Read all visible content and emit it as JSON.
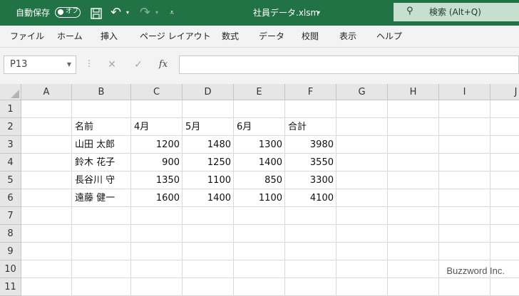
{
  "titlebar": {
    "autosave_label": "自動保存",
    "autosave_state": "オフ",
    "filename": "社員データ.xlsm",
    "search_placeholder": "検索 (Alt+Q)"
  },
  "menu": [
    "ファイル",
    "ホーム",
    "挿入",
    "ページ レイアウト",
    "数式",
    "データ",
    "校閲",
    "表示",
    "ヘルプ"
  ],
  "formula_bar": {
    "name_box": "P13",
    "fx_label": "fx",
    "content": ""
  },
  "sheet": {
    "columns": [
      "A",
      "B",
      "C",
      "D",
      "E",
      "F",
      "G",
      "H",
      "I",
      "J"
    ],
    "rows": [
      "1",
      "2",
      "3",
      "4",
      "5",
      "6",
      "7",
      "8",
      "9",
      "10",
      "11"
    ],
    "cells": {
      "B2": "名前",
      "C2": "4月",
      "D2": "5月",
      "E2": "6月",
      "F2": "合計",
      "B3": "山田 太郎",
      "C3": "1200",
      "D3": "1480",
      "E3": "1300",
      "F3": "3980",
      "B4": "鈴木 花子",
      "C4": "900",
      "D4": "1250",
      "E4": "1400",
      "F4": "3550",
      "B5": "長谷川 守",
      "C5": "1350",
      "D5": "1100",
      "E5": "850",
      "F5": "3300",
      "B6": "遠藤 健一",
      "C6": "1600",
      "D6": "1400",
      "E6": "1100",
      "F6": "4100"
    }
  },
  "watermark": "Buzzword Inc."
}
